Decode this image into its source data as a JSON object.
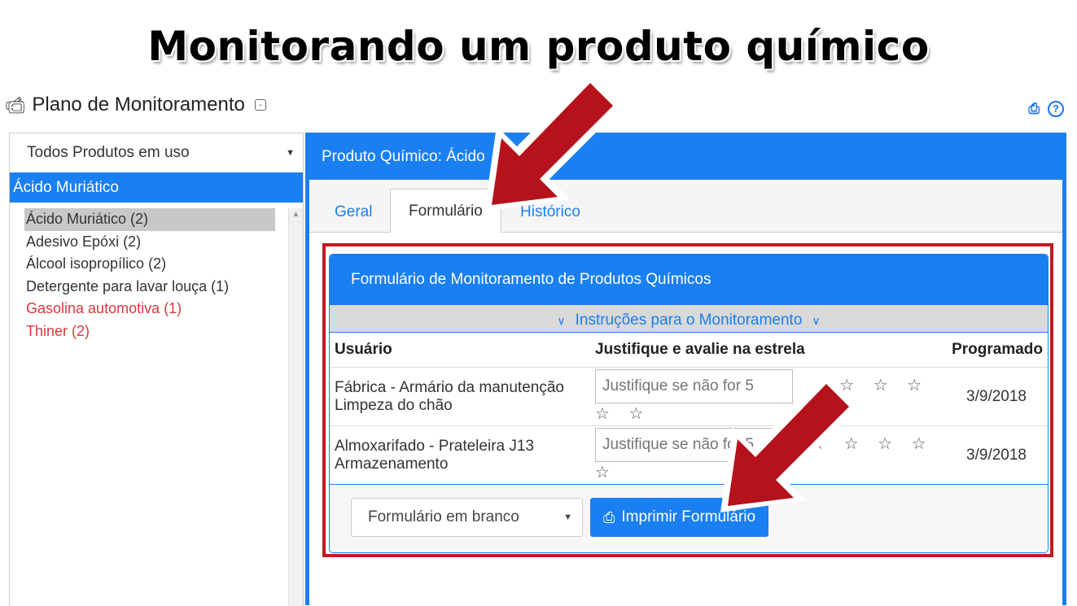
{
  "slide": {
    "title": "Monitorando um produto químico"
  },
  "app": {
    "title": "Plano de Monitoramento",
    "camera_icon": "camera-icon",
    "lock_icon": "lock-icon",
    "print_icon": "printer-icon",
    "help_icon": "help-icon"
  },
  "sidebar": {
    "filter_value": "Todos Produtos em uso",
    "selected_label": "Ácido Muriático",
    "items": [
      {
        "label": "Ácido Muriático (2)",
        "state": "active"
      },
      {
        "label": "Adesivo Epóxi (2)",
        "state": "normal"
      },
      {
        "label": "Álcool isopropílico (2)",
        "state": "normal"
      },
      {
        "label": "Detergente para lavar louça (1)",
        "state": "normal"
      },
      {
        "label": "Gasolina automotiva (1)",
        "state": "alert"
      },
      {
        "label": "Thiner (2)",
        "state": "alert"
      }
    ]
  },
  "main": {
    "header": "Produto Químico: Ácido",
    "tabs": [
      {
        "label": "Geral",
        "active": false
      },
      {
        "label": "Formulário",
        "active": true
      },
      {
        "label": "Histórico",
        "active": false
      }
    ],
    "form": {
      "title": "Formulário de Monitoramento de Produtos Químicos",
      "instructions": "Instruções para o Monitoramento",
      "columns": {
        "user": "Usuário",
        "justify": "Justifique e avalie na estrela",
        "scheduled": "Programado"
      },
      "rows": [
        {
          "user_line1": "Fábrica - Armário da manutenção",
          "user_line2": "Limpeza do chão",
          "placeholder": "Justifique se não for 5",
          "stars": "☆ ☆ ☆ ☆ ☆",
          "date": "3/9/2018"
        },
        {
          "user_line1": "Almoxarifado - Prateleira J13",
          "user_line2": "Armazenamento",
          "placeholder": "Justifique se não for 5",
          "stars": "☆ ☆ ☆ ☆ ☆",
          "date": "3/9/2018"
        }
      ],
      "footer": {
        "select_value": "Formulário em branco",
        "print_label": "Imprimir Formulário"
      }
    }
  },
  "colors": {
    "accent": "#1a7ff0",
    "highlight": "#c21a22",
    "alert_text": "#d9363e"
  }
}
